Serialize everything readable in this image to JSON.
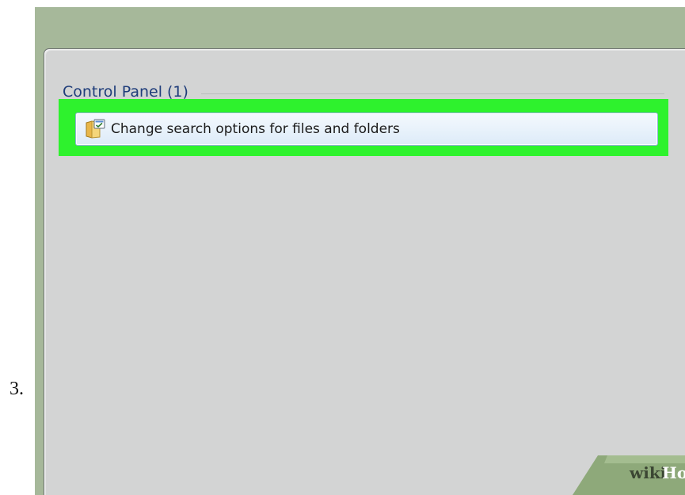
{
  "step": {
    "number": "3."
  },
  "search_results": {
    "section_title": "Control Panel (1)",
    "items": [
      {
        "label": "Change search options for files and folders",
        "icon": "folder-options-icon",
        "highlighted": true
      }
    ]
  },
  "watermark": {
    "wiki": "wiki",
    "how": "How"
  },
  "colors": {
    "desktop_background": "#a6b89a",
    "panel_background": "#d3d4d4",
    "section_title": "#1f3d7a",
    "highlight": "#2ef22d",
    "result_row_border": "#8fb3d6"
  }
}
